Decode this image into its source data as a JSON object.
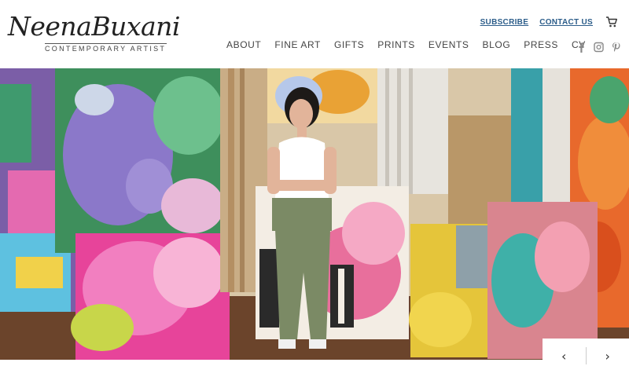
{
  "brand": {
    "name": "NeenaBuxani",
    "tagline": "CONTEMPORARY ARTIST"
  },
  "utility": {
    "subscribe": "SUBSCRIBE",
    "contact": "CONTACT US",
    "cart_icon": "cart-icon"
  },
  "nav": {
    "items": [
      "ABOUT",
      "FINE ART",
      "GIFTS",
      "PRINTS",
      "EVENTS",
      "BLOG",
      "PRESS",
      "CV"
    ]
  },
  "social": {
    "icons": [
      "facebook-icon",
      "instagram-icon",
      "pinterest-icon"
    ]
  },
  "slider": {
    "prev": "‹",
    "next": "›"
  },
  "colors": {
    "link": "#2c5d8a",
    "nav_text": "#444444"
  }
}
